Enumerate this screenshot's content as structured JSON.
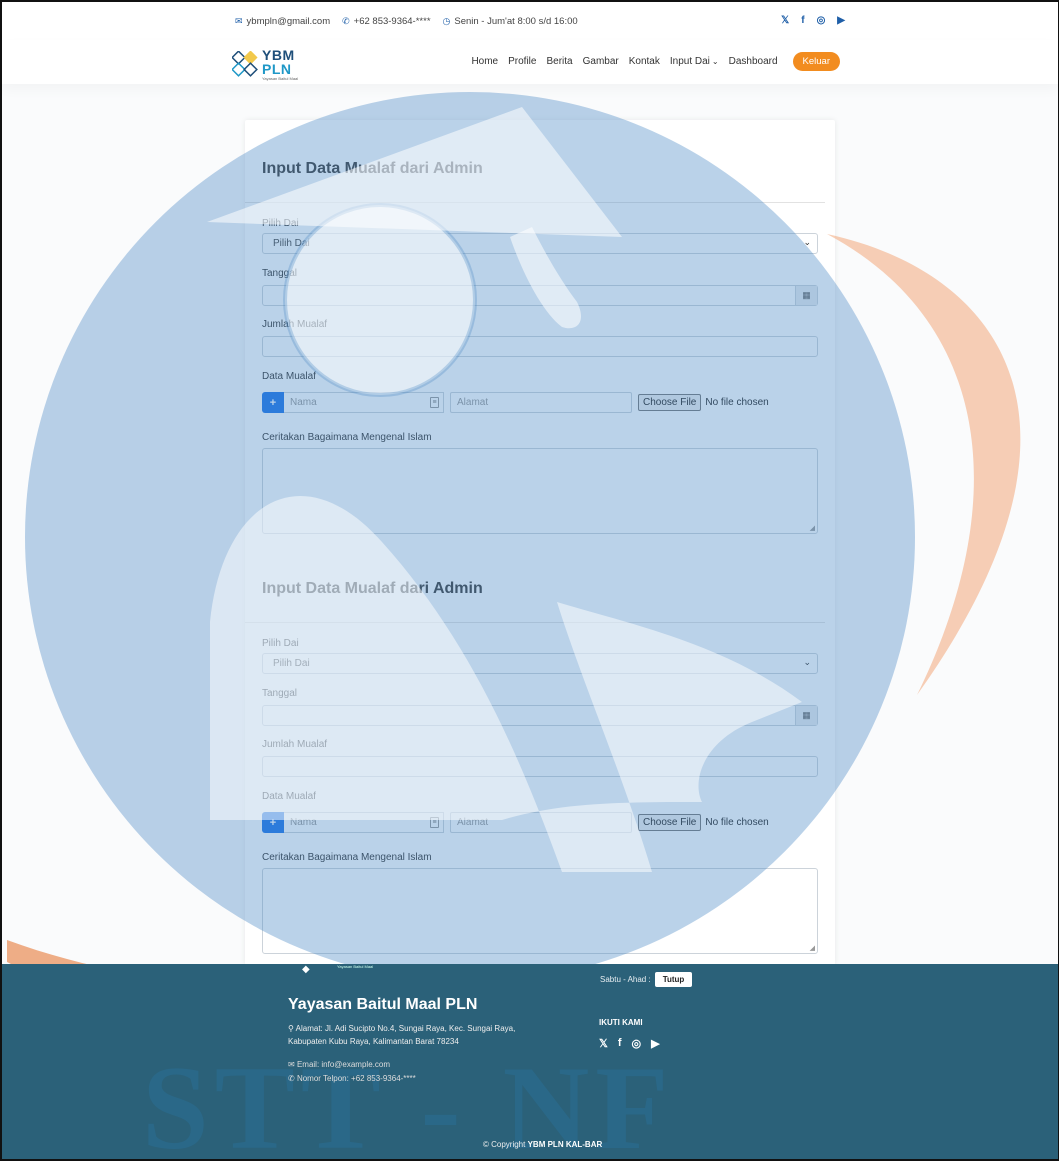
{
  "topbar": {
    "email": "ybmpln@gmail.com",
    "phone": "+62 853-9364-****",
    "hours": "Senin - Jum'at 8:00 s/d 16:00",
    "social_icons": [
      "twitter-icon",
      "facebook-icon",
      "instagram-icon",
      "youtube-icon"
    ]
  },
  "brand": {
    "line1": "YBM",
    "line2": "PLN",
    "tagline": "Yayasan Baitul Maal"
  },
  "nav": {
    "home": "Home",
    "profile": "Profile",
    "berita": "Berita",
    "gambar": "Gambar",
    "kontak": "Kontak",
    "input_dai": "Input Dai",
    "dashboard": "Dashboard",
    "logout": "Keluar"
  },
  "forms": [
    {
      "title": "Input Data Mualaf dari Admin",
      "dai_label": "Pilih Dai",
      "dai_value": "Pilih Dai",
      "tanggal_label": "Tanggal",
      "jumlah_label": "Jumlah Mualaf",
      "data_label": "Data Mualaf",
      "nama_placeholder": "Nama",
      "alamat_placeholder": "Alamat",
      "file_button": "Choose File",
      "file_status": "No file chosen",
      "cerita_label": "Ceritakan Bagaimana Mengenal Islam"
    },
    {
      "title": "Input Data Mualaf dari Admin",
      "dai_label": "Pilih Dai",
      "dai_value": "Pilih Dai",
      "tanggal_label": "Tanggal",
      "jumlah_label": "Jumlah Mualaf",
      "data_label": "Data Mualaf",
      "nama_placeholder": "Nama",
      "alamat_placeholder": "Alamat",
      "file_button": "Choose File",
      "file_status": "No file chosen",
      "cerita_label": "Ceritakan Bagaimana Mengenal Islam"
    }
  ],
  "footer": {
    "org_name": "Yayasan Baitul Maal PLN",
    "mini_logo_text": "Yayasan Baitul Maal",
    "address_line1": "Alamat: Jl. Adi Sucipto No.4, Sungai Raya, Kec. Sungai Raya,",
    "address_line2": "Kabupaten Kubu Raya, Kalimantan Barat 78234",
    "email": "Email: info@example.com",
    "phone": "Nomor Telpon: +62 853-9364-****",
    "hours_label": "Sabtu - Ahad :",
    "hours_status": "Tutup",
    "follow_title": "IKUTI KAMI",
    "watermark_text": "STT - NF",
    "copyright_prefix": "© Copyright",
    "copyright_brand": "YBM PLN KAL-BAR"
  },
  "colors": {
    "primary": "#1a73e8",
    "accent": "#f28c1f",
    "footer_bg": "#2b6179",
    "watermark_blue": "#4a88c5",
    "watermark_orange": "#f2a77a"
  }
}
